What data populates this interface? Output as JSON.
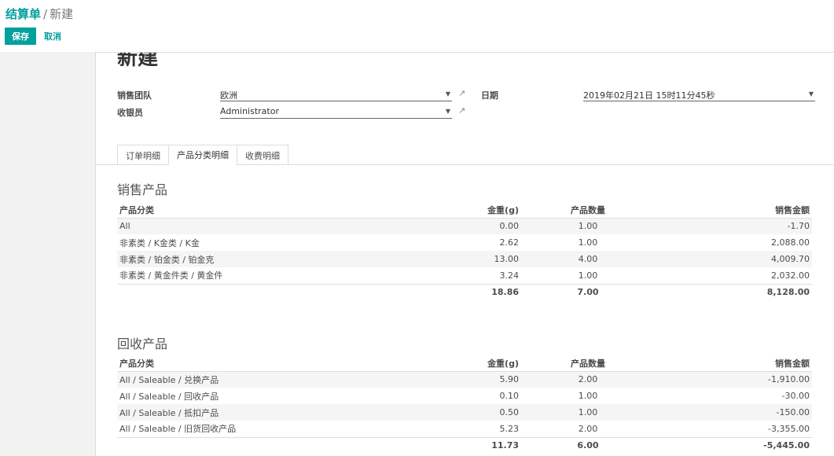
{
  "breadcrumb": {
    "parent": "结算单",
    "separator": "/",
    "current": "新建"
  },
  "toolbar": {
    "save_label": "保存",
    "cancel_label": "取消"
  },
  "form": {
    "title": "新建",
    "sales_team_label": "销售团队",
    "sales_team_value": "欧洲",
    "cashier_label": "收银员",
    "cashier_value": "Administrator",
    "date_label": "日期",
    "date_value": "2019年02月21日 15时11分45秒"
  },
  "tabs": [
    {
      "label": "订单明细"
    },
    {
      "label": "产品分类明细"
    },
    {
      "label": "收费明细"
    }
  ],
  "sales": {
    "title": "销售产品",
    "headers": [
      "产品分类",
      "金重(g)",
      "产品数量",
      "销售金额"
    ],
    "rows": [
      [
        "All",
        "0.00",
        "1.00",
        "-1.70"
      ],
      [
        "非素类 / K金类 / K金",
        "2.62",
        "1.00",
        "2,088.00"
      ],
      [
        "非素类 / 铂金类 / 铂金克",
        "13.00",
        "4.00",
        "4,009.70"
      ],
      [
        "非素类 / 黄金件类 / 黄金件",
        "3.24",
        "1.00",
        "2,032.00"
      ]
    ],
    "totals": [
      "",
      "18.86",
      "7.00",
      "8,128.00"
    ]
  },
  "recycle": {
    "title": "回收产品",
    "headers": [
      "产品分类",
      "金重(g)",
      "产品数量",
      "销售金额"
    ],
    "rows": [
      [
        "All / Saleable / 兑换产品",
        "5.90",
        "2.00",
        "-1,910.00"
      ],
      [
        "All / Saleable / 回收产品",
        "0.10",
        "1.00",
        "-30.00"
      ],
      [
        "All / Saleable / 抵扣产品",
        "0.50",
        "1.00",
        "-150.00"
      ],
      [
        "All / Saleable / 旧货回收产品",
        "5.23",
        "2.00",
        "-3,355.00"
      ]
    ],
    "totals": [
      "",
      "11.73",
      "6.00",
      "-5,445.00"
    ]
  }
}
